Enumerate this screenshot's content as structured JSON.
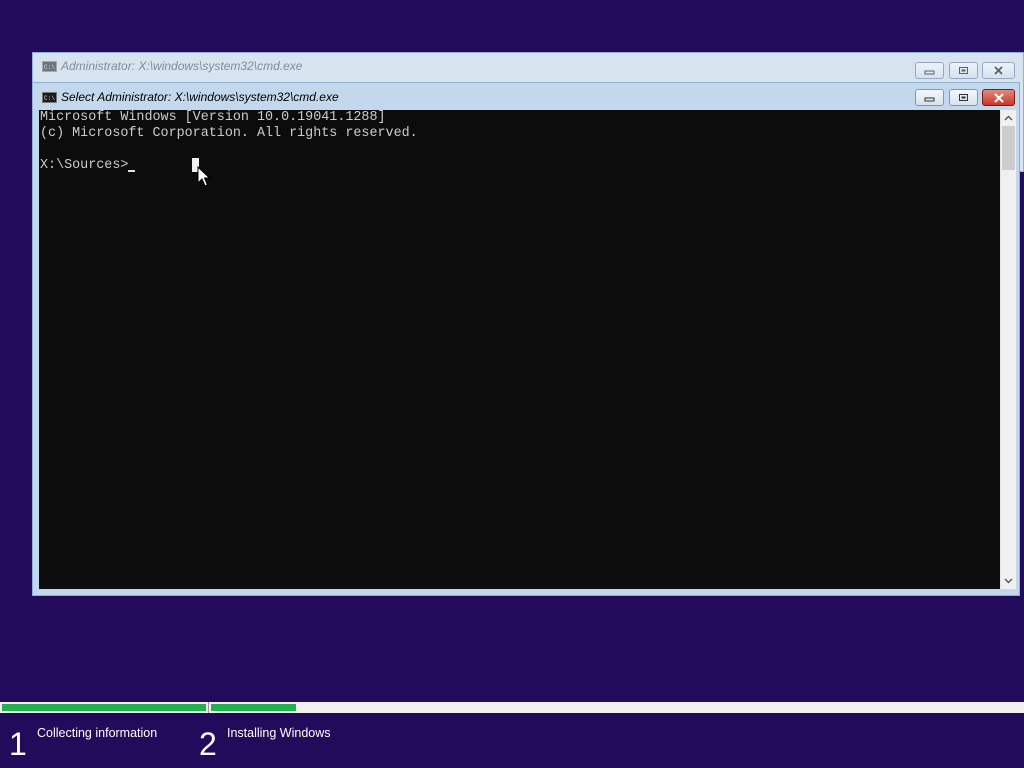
{
  "background_color": "#230b5c",
  "windows": {
    "back": {
      "title": "Administrator: X:\\windows\\system32\\cmd.exe",
      "icon": "cmd-icon"
    },
    "front": {
      "title": "Select Administrator: X:\\windows\\system32\\cmd.exe",
      "icon": "cmd-icon"
    }
  },
  "console": {
    "lines": [
      "Microsoft Windows [Version 10.0.19041.1288]",
      "(c) Microsoft Corporation. All rights reserved.",
      "",
      "X:\\Sources>"
    ],
    "text_color": "#cccccc",
    "background": "#0c0c0c"
  },
  "setup_progress": {
    "accent": "#22b14c",
    "steps": [
      {
        "number": "1",
        "label": "Collecting information",
        "progress": 1.0
      },
      {
        "number": "2",
        "label": "Installing Windows",
        "progress": 0.105
      }
    ]
  }
}
